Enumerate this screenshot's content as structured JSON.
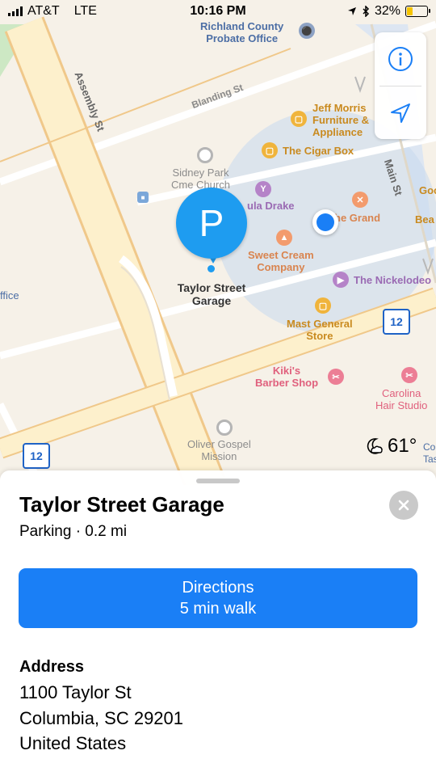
{
  "status_bar": {
    "carrier": "AT&T",
    "network": "LTE",
    "time": "10:16 PM",
    "battery_percent": "32%",
    "battery_level": 0.32,
    "location_icon": "location-arrow-icon",
    "bluetooth_icon": "bluetooth-icon"
  },
  "map": {
    "streets": {
      "assembly": "Assembly St",
      "blanding": "Blanding St",
      "main": "Main St"
    },
    "pois": {
      "probate_office": [
        "Richland County",
        "Probate Office"
      ],
      "jeff_morris": [
        "Jeff Morris",
        "Furniture &",
        "Appliance"
      ],
      "cigar_box": "The Cigar Box",
      "sidney_park": [
        "Sidney Park",
        "Cme Church"
      ],
      "drake": "ula Drake",
      "the_grand": "he Grand",
      "sweet_cream": [
        "Sweet Cream",
        "Company"
      ],
      "nickelodeon": "The Nickelodeo",
      "mast_general": [
        "Mast General",
        "Store"
      ],
      "kikis": [
        "Kiki's",
        "Barber Shop"
      ],
      "carolina_hair": [
        "Carolina",
        "Hair Studio"
      ],
      "oliver_gospel": [
        "Oliver Gospel",
        "Mission"
      ],
      "goo_partial": "Goo",
      "bea_partial": "Bea",
      "ffice_partial": "ffice",
      "co_partial": [
        "Co",
        "Tase"
      ]
    },
    "pin": {
      "letter": "P",
      "label": [
        "Taylor Street",
        "Garage"
      ]
    },
    "route_shield": "12",
    "weather": {
      "temp": "61°",
      "icon": "moon-cloud-icon"
    },
    "controls": {
      "info_icon": "info-icon",
      "location_icon": "location-arrow-icon"
    },
    "colors": {
      "park_green": "#cde8c4",
      "primary_road": "#fdf0cc",
      "primary_road_edge": "#f0c88a",
      "water": "#dde6f2",
      "location_accent": "#1a7ff6"
    }
  },
  "sheet": {
    "title": "Taylor Street Garage",
    "subtitle": "Parking · 0.2 mi",
    "directions": {
      "label": "Directions",
      "sub": "5 min walk"
    },
    "address": {
      "heading": "Address",
      "lines": [
        "1100 Taylor St",
        "Columbia, SC  29201",
        "United States"
      ]
    },
    "close_icon": "close-icon"
  }
}
